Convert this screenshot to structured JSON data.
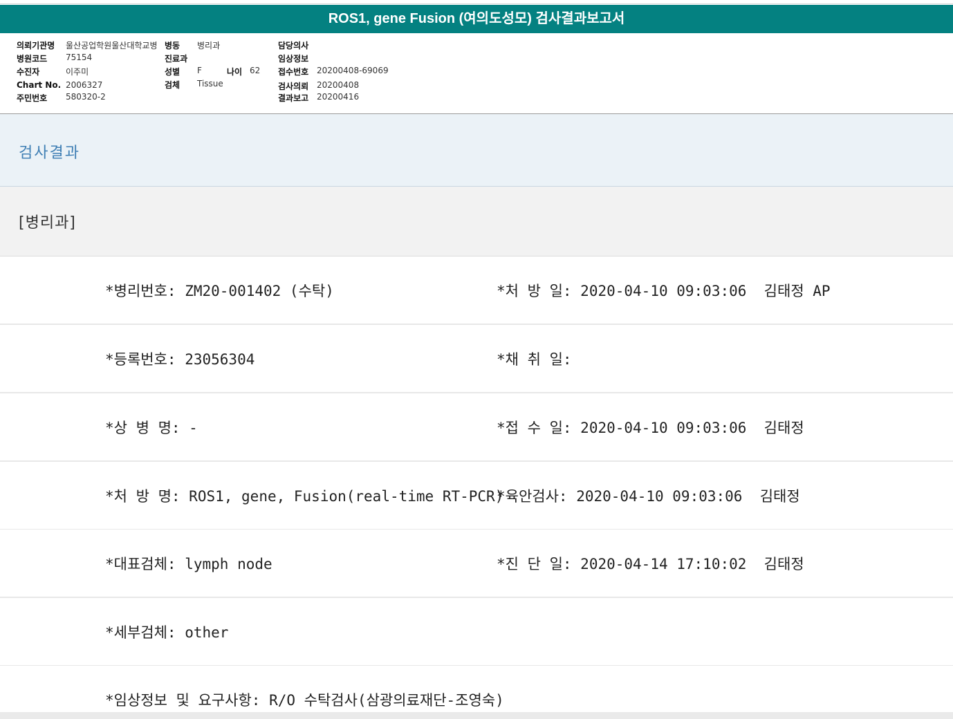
{
  "title": "ROS1, gene Fusion (여의도성모) 검사결과보고서",
  "info": {
    "institution_label": "의뢰기관명",
    "institution": "울산공업학원울산대학교병",
    "ward_label": "병동",
    "ward": "병리과",
    "doctor_label": "담당의사",
    "doctor": "",
    "hospital_code_label": "병원코드",
    "hospital_code": "75154",
    "dept_label": "진료과",
    "dept": "",
    "clinical_label": "임상정보",
    "clinical": "",
    "patient_label": "수진자",
    "patient": "이주미",
    "sex_label": "성별",
    "sex": "F",
    "age_label": "나이",
    "age": "62",
    "receipt_label": "접수번호",
    "receipt": "20200408-69069",
    "chart_label": "Chart No.",
    "chart": "2006327",
    "specimen_label": "검체",
    "specimen": "Tissue",
    "request_label": "검사의뢰",
    "request": "20200408",
    "resident_label": "주민번호",
    "resident": "580320-2",
    "report_label": "결과보고",
    "report": "20200416"
  },
  "section_title": "검사결과",
  "department": "[병리과]",
  "rows": [
    {
      "left": "*병리번호: ZM20-001402 (수탁)",
      "right": "*처 방 일: 2020-04-10 09:03:06  김태정 AP"
    },
    {
      "left": "*등록번호: 23056304",
      "right": "*채 취 일:"
    },
    {
      "left": "*상 병 명: -",
      "right": "*접 수 일: 2020-04-10 09:03:06  김태정"
    },
    {
      "left": "*처 방 명: ROS1, gene, Fusion(real-time RT-PCR)",
      "right": "*육안검사: 2020-04-10 09:03:06  김태정"
    },
    {
      "left": "*대표검체: lymph node",
      "right": "*진 단 일: 2020-04-14 17:10:02  김태정"
    },
    {
      "left": "*세부검체: other",
      "right": ""
    },
    {
      "left": "*임상정보 및 요구사항: R/O 수탁검사(삼광의료재단-조영숙)",
      "right": ""
    }
  ]
}
